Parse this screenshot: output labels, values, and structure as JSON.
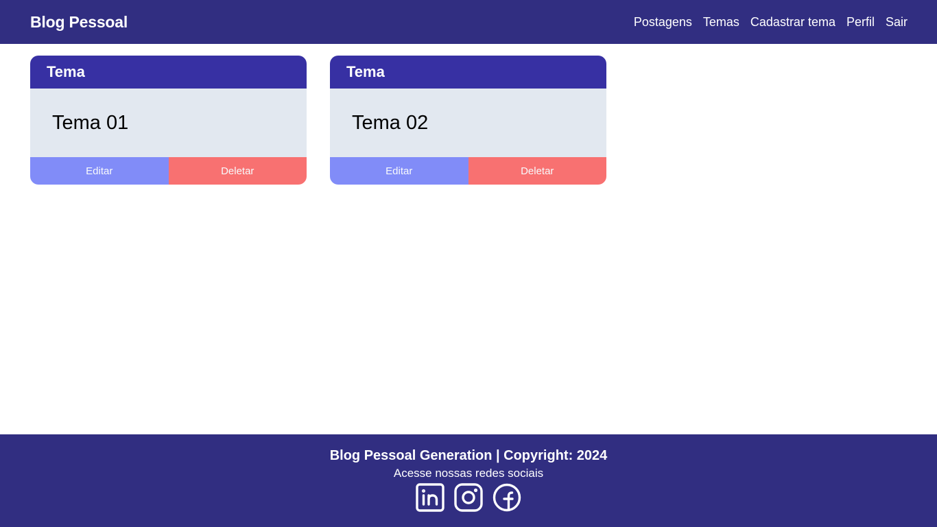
{
  "navbar": {
    "brand": "Blog Pessoal",
    "links": [
      "Postagens",
      "Temas",
      "Cadastrar tema",
      "Perfil",
      "Sair"
    ]
  },
  "cards": [
    {
      "header": "Tema",
      "title": "Tema 01",
      "edit_label": "Editar",
      "delete_label": "Deletar"
    },
    {
      "header": "Tema",
      "title": "Tema 02",
      "edit_label": "Editar",
      "delete_label": "Deletar"
    }
  ],
  "footer": {
    "title": "Blog Pessoal Generation | Copyright: 2024",
    "subtitle": "Acesse nossas redes sociais",
    "socials": [
      "linkedin-icon",
      "instagram-icon",
      "facebook-icon"
    ]
  },
  "colors": {
    "navbar_bg": "#312e81",
    "card_header_bg": "#3730a3",
    "card_body_bg": "#e2e8f0",
    "edit_button": "#818cf8",
    "delete_button": "#f87171"
  }
}
